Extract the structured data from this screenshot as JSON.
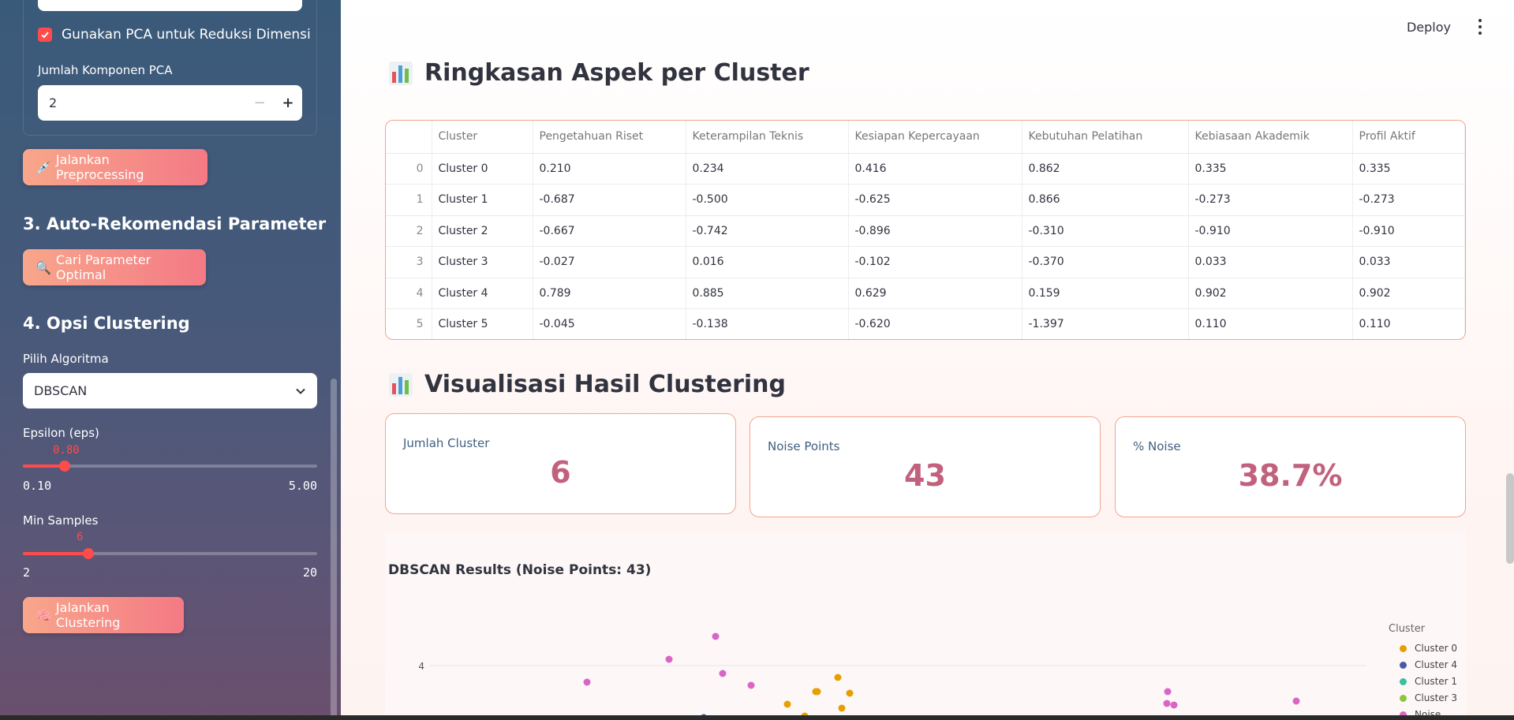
{
  "sidebar": {
    "pca_checkbox_label": "Gunakan PCA untuk Reduksi Dimensi",
    "pca_components_label": "Jumlah Komponen PCA",
    "pca_components_value": "2",
    "preprocess_button": "Jalankan Preprocessing",
    "preprocess_icon": "syringe-icon",
    "section3_title": "3. Auto-Rekomendasi Parameter",
    "find_params_button": "Cari Parameter Optimal",
    "find_params_icon": "magnifier-icon",
    "section4_title": "4. Opsi Clustering",
    "algorithm_label": "Pilih Algoritma",
    "algorithm_value": "DBSCAN",
    "eps_label": "Epsilon (eps)",
    "eps_value": "0.80",
    "eps_fraction": 0.143,
    "eps_min": "0.10",
    "eps_max": "5.00",
    "min_samples_label": "Min Samples",
    "min_samples_value": "6",
    "min_samples_fraction": 0.222,
    "min_samples_min": "2",
    "min_samples_max": "20",
    "cluster_button": "Jalankan Clustering",
    "cluster_icon": "brain-icon"
  },
  "header": {
    "deploy_label": "Deploy"
  },
  "summary": {
    "title": "Ringkasan Aspek per Cluster",
    "columns": [
      "",
      "Cluster",
      "Pengetahuan Riset",
      "Keterampilan Teknis",
      "Kesiapan Kepercayaan",
      "Kebutuhan Pelatihan",
      "Kebiasaan Akademik",
      "Profil Aktif"
    ],
    "rows": [
      [
        "0",
        "Cluster 0",
        "0.210",
        "0.234",
        "0.416",
        "0.862",
        "0.335",
        "0.335"
      ],
      [
        "1",
        "Cluster 1",
        "-0.687",
        "-0.500",
        "-0.625",
        "0.866",
        "-0.273",
        "-0.273"
      ],
      [
        "2",
        "Cluster 2",
        "-0.667",
        "-0.742",
        "-0.896",
        "-0.310",
        "-0.910",
        "-0.910"
      ],
      [
        "3",
        "Cluster 3",
        "-0.027",
        "0.016",
        "-0.102",
        "-0.370",
        "0.033",
        "0.033"
      ],
      [
        "4",
        "Cluster 4",
        "0.789",
        "0.885",
        "0.629",
        "0.159",
        "0.902",
        "0.902"
      ],
      [
        "5",
        "Cluster 5",
        "-0.045",
        "-0.138",
        "-0.620",
        "-1.397",
        "0.110",
        "0.110"
      ]
    ]
  },
  "visual": {
    "title": "Visualisasi Hasil Clustering",
    "metrics": [
      {
        "label": "Jumlah Cluster",
        "value": "6"
      },
      {
        "label": "Noise Points",
        "value": "43"
      },
      {
        "label": "% Noise",
        "value": "38.7%"
      }
    ]
  },
  "plot": {
    "title": "DBSCAN Results (Noise Points: 43)",
    "ytick": "4",
    "legend_title": "Cluster",
    "legend": [
      {
        "name": "Cluster 0",
        "color": "#e69f00"
      },
      {
        "name": "Cluster 4",
        "color": "#4b5aa8"
      },
      {
        "name": "Cluster 1",
        "color": "#3dbfa0"
      },
      {
        "name": "Cluster 3",
        "color": "#8cc63f"
      },
      {
        "name": "Noise",
        "color": "#d966c4"
      }
    ]
  },
  "colors": {
    "accent": "#ff4b4b",
    "metric_value": "#c2617d",
    "card_border": "#f4a48e"
  }
}
